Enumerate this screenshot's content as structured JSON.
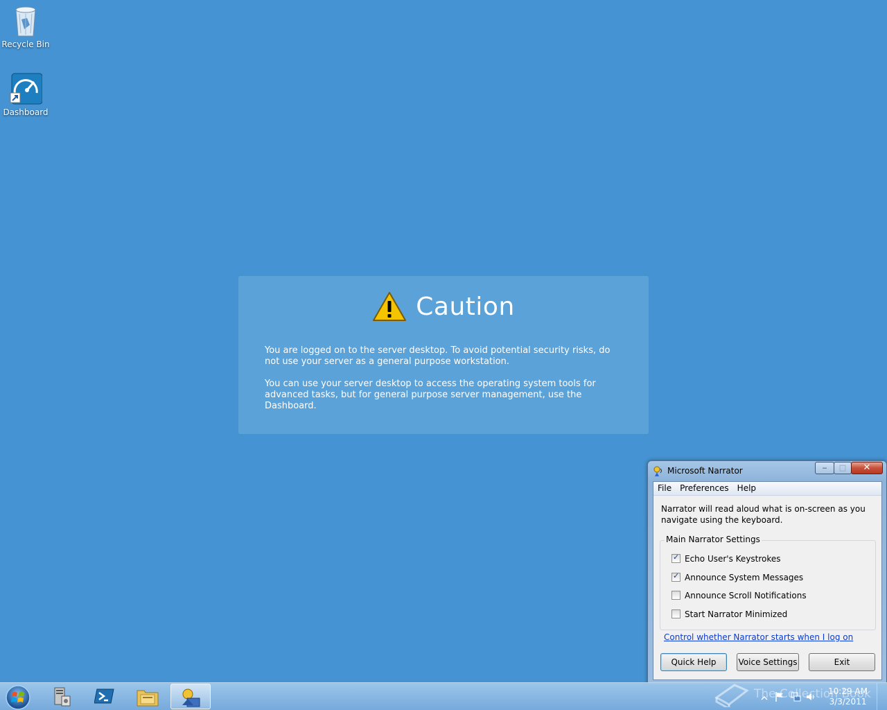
{
  "desktop": {
    "icons": [
      {
        "label": "Recycle Bin",
        "icon": "recycle-bin-icon"
      },
      {
        "label": "Dashboard",
        "icon": "dashboard-icon"
      }
    ]
  },
  "caution": {
    "title": "Caution",
    "icon": "warning-icon",
    "paragraph1": "You are logged on to the server desktop. To avoid potential security risks, do not use your server as a general purpose workstation.",
    "paragraph2": "You can use your server desktop to access the operating system tools for advanced tasks, but for general purpose server management, use the Dashboard."
  },
  "narrator": {
    "title": "Microsoft Narrator",
    "window_controls": {
      "minimize": "‒",
      "maximize": "□",
      "close": "✕"
    },
    "menu": [
      "File",
      "Preferences",
      "Help"
    ],
    "description": "Narrator will read aloud what is on-screen as you navigate using the keyboard.",
    "group_title": "Main Narrator Settings",
    "checkboxes": [
      {
        "label": "Echo User's Keystrokes",
        "checked": true
      },
      {
        "label": "Announce System Messages",
        "checked": true
      },
      {
        "label": "Announce Scroll Notifications",
        "checked": false
      },
      {
        "label": "Start Narrator Minimized",
        "checked": false
      }
    ],
    "link": "Control whether Narrator starts when I log on",
    "buttons": {
      "quick_help": "Quick Help",
      "voice_settings": "Voice Settings",
      "exit": "Exit"
    }
  },
  "taskbar": {
    "pinned": [
      "server-manager-icon",
      "powershell-icon",
      "file-explorer-icon",
      "narrator-icon"
    ],
    "clock": {
      "time": "10:29 AM",
      "date": "3/3/2011"
    },
    "watermark": "The Collection Book"
  },
  "colors": {
    "desktop": "#4593d2",
    "panel": "#5aa2d8"
  }
}
